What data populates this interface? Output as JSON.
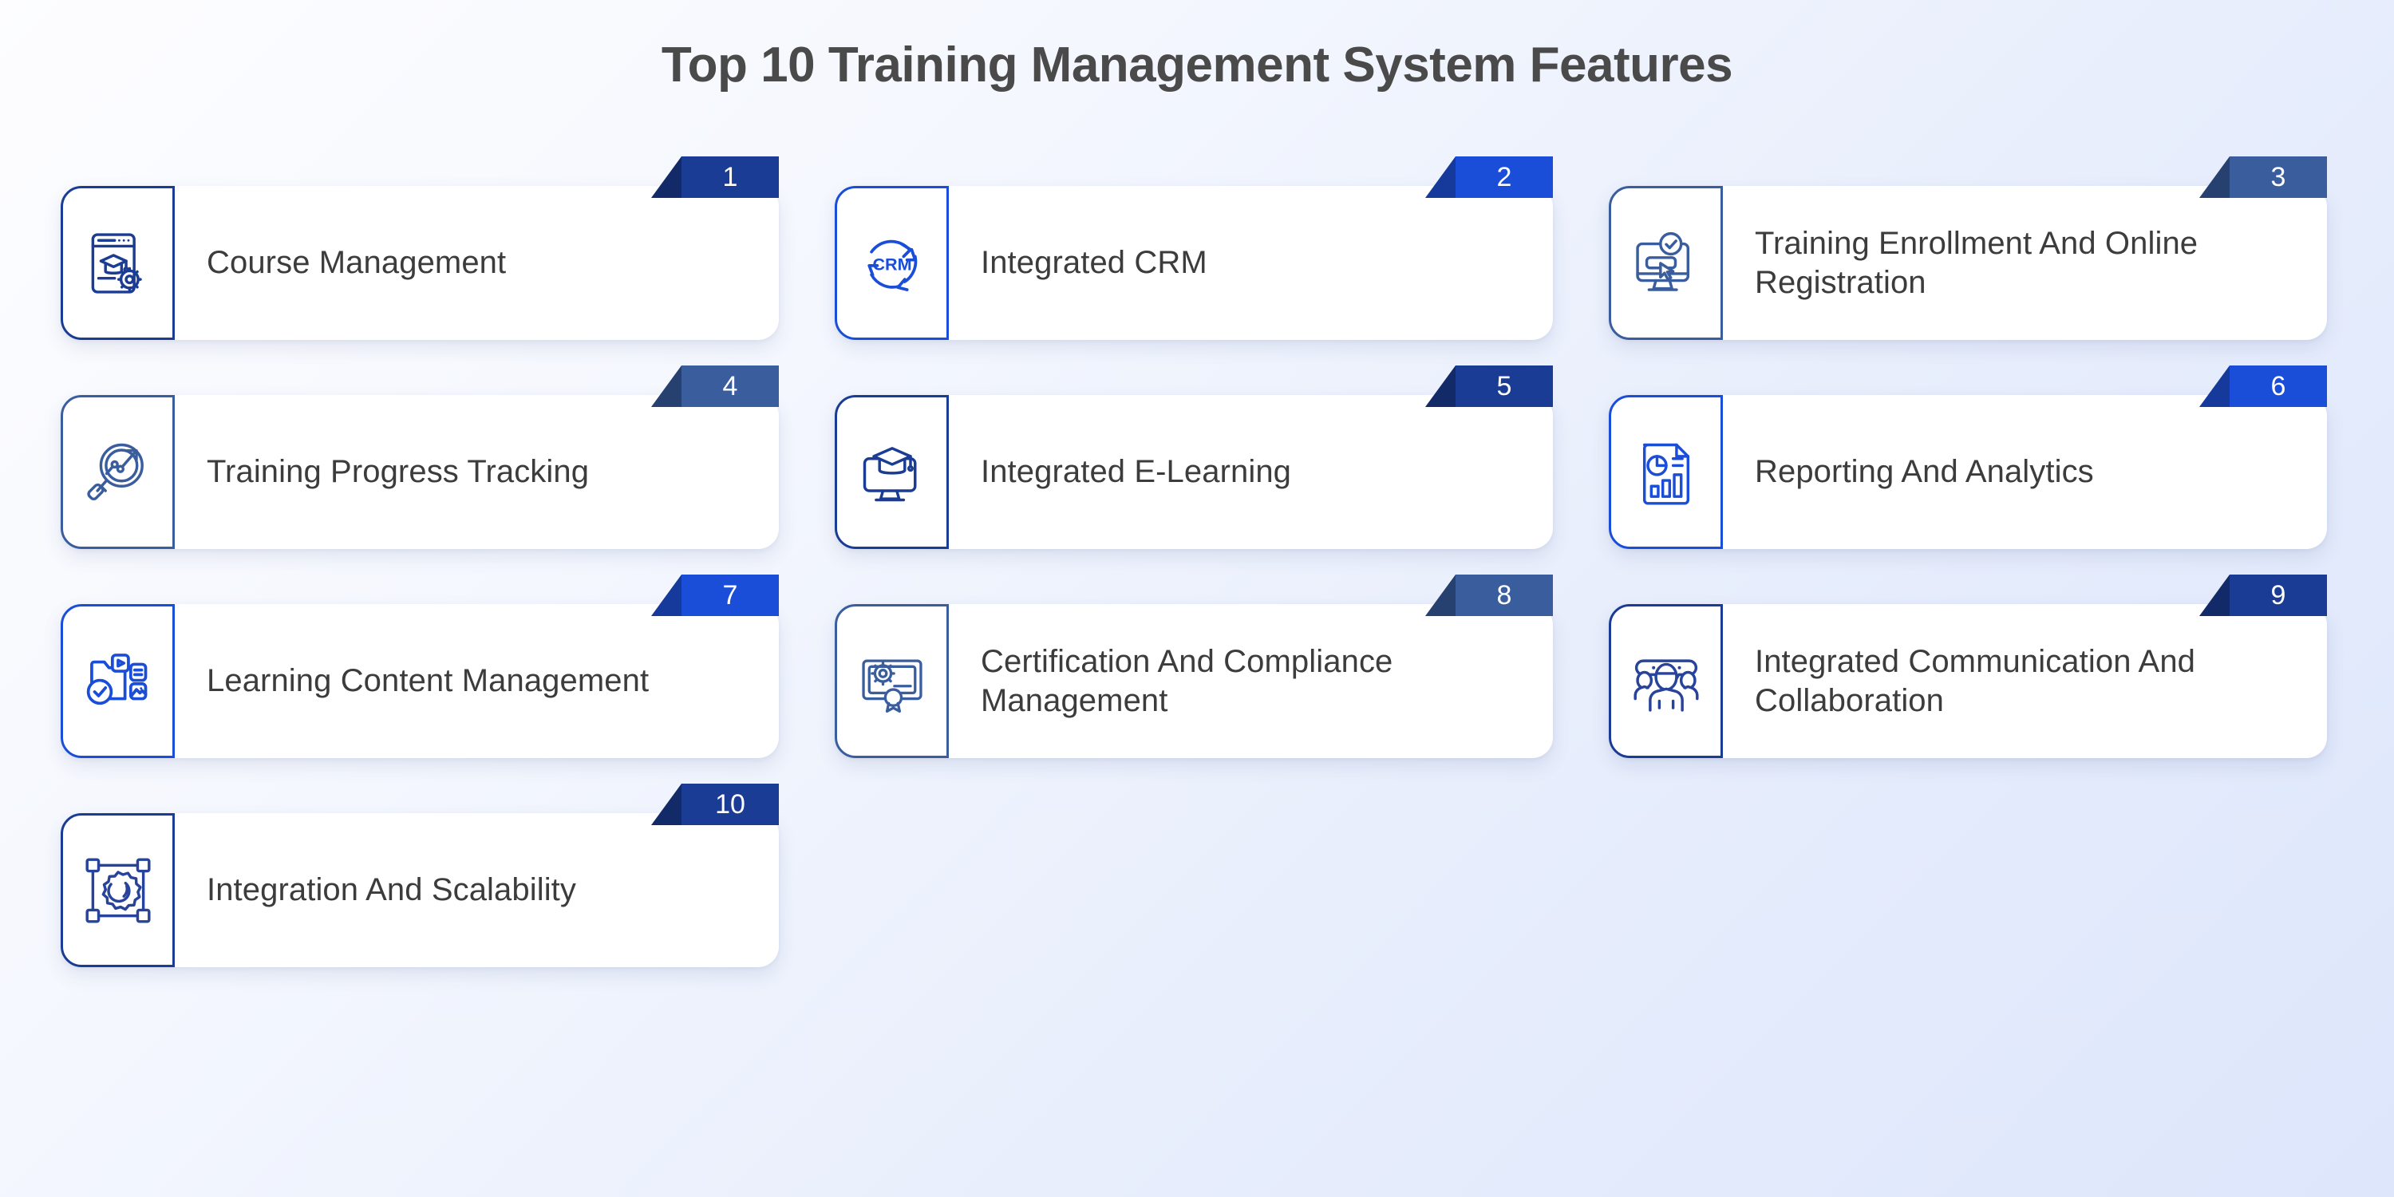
{
  "header": {
    "title": "Top 10 Training Management System Features"
  },
  "colors": {
    "deep_blue": "#1b3c94",
    "bright_blue": "#1a4ed8",
    "muted_blue": "#3a5d9e",
    "fold_deep": "#132a68",
    "fold_bright": "#16399c",
    "fold_muted": "#26406f",
    "text_dark": "#3c3c3c",
    "title_gray": "#4a4a4a",
    "card_white": "#ffffff",
    "background_start": "#fdfdff",
    "background_end": "#dde6fb"
  },
  "cards": [
    {
      "number": "1",
      "label": "Course Management",
      "icon": "course-management-icon",
      "tone": "deep"
    },
    {
      "number": "2",
      "label": "Integrated CRM",
      "icon": "crm-cycle-icon",
      "tone": "bright"
    },
    {
      "number": "3",
      "label": "Training Enrollment And Online Registration",
      "icon": "monitor-check-cursor-icon",
      "tone": "muted"
    },
    {
      "number": "4",
      "label": "Training Progress Tracking",
      "icon": "magnifier-trend-icon",
      "tone": "muted"
    },
    {
      "number": "5",
      "label": "Integrated E-Learning",
      "icon": "monitor-graduation-cap-icon",
      "tone": "deep"
    },
    {
      "number": "6",
      "label": "Reporting And Analytics",
      "icon": "report-chart-icon",
      "tone": "bright"
    },
    {
      "number": "7",
      "label": "Learning Content Management",
      "icon": "folder-media-check-icon",
      "tone": "bright"
    },
    {
      "number": "8",
      "label": "Certification And Compliance Management",
      "icon": "certificate-gear-icon",
      "tone": "muted"
    },
    {
      "number": "9",
      "label": "Integrated Communication And Collaboration",
      "icon": "people-speech-bubble-icon",
      "tone": "deep"
    },
    {
      "number": "10",
      "label": "Integration And Scalability",
      "icon": "gear-bounding-box-icon",
      "tone": "deep"
    }
  ]
}
